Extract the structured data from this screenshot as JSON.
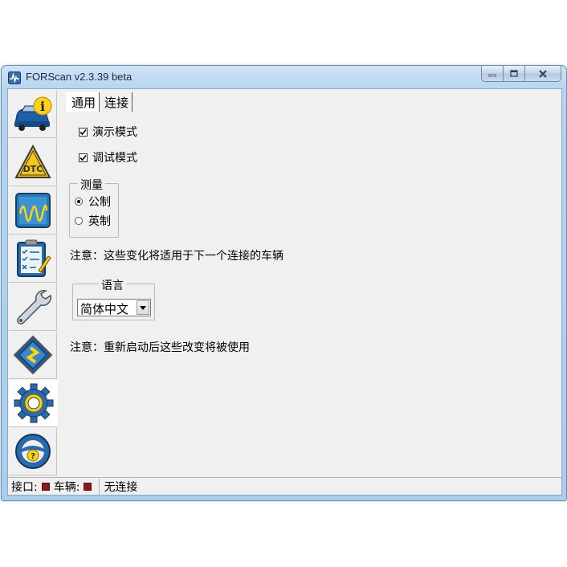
{
  "window": {
    "title": "FORScan v2.3.39 beta"
  },
  "sidebar": {
    "items": [
      {
        "name": "vehicle-info",
        "icon": "car-info-icon"
      },
      {
        "name": "dtc",
        "icon": "dtc-warning-icon"
      },
      {
        "name": "oscilloscope",
        "icon": "oscilloscope-icon"
      },
      {
        "name": "tests",
        "icon": "checklist-icon"
      },
      {
        "name": "service",
        "icon": "wrench-icon"
      },
      {
        "name": "configuration",
        "icon": "chip-icon"
      },
      {
        "name": "settings",
        "icon": "gear-icon",
        "active": true
      },
      {
        "name": "help",
        "icon": "steering-help-icon"
      }
    ]
  },
  "tabs": [
    {
      "label": "通用",
      "selected": true
    },
    {
      "label": "连接",
      "selected": false
    }
  ],
  "general": {
    "demo_mode": {
      "label": "演示模式",
      "checked": true
    },
    "debug_mode": {
      "label": "调试模式",
      "checked": true
    },
    "measure_group": {
      "title": "测量",
      "options": [
        {
          "label": "公制",
          "selected": true
        },
        {
          "label": "英制",
          "selected": false
        }
      ]
    },
    "note_vehicle": "注意：这些变化将适用于下一个连接的车辆",
    "language_group": {
      "title": "语言",
      "selected": "简体中文"
    },
    "note_restart": "注意：重新启动后这些改变将被使用"
  },
  "statusbar": {
    "port_label": "接口:",
    "vehicle_label": "车辆:",
    "connection_status": "无连接",
    "led_color": "#8b1a1a"
  }
}
